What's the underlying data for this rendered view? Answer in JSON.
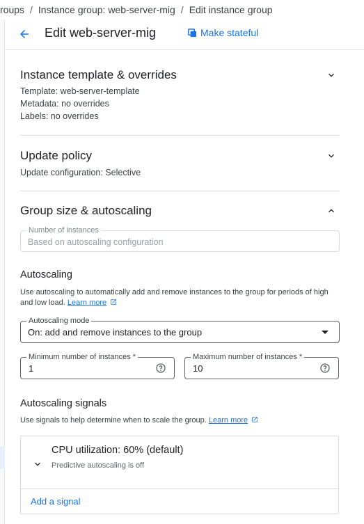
{
  "breadcrumb": {
    "items": [
      "roups",
      "Instance group: web-server-mig",
      "Edit instance group"
    ],
    "separator": "/"
  },
  "header": {
    "title": "Edit web-server-mig",
    "make_stateful_label": "Make stateful",
    "back_icon": "arrow-back-icon"
  },
  "template_section": {
    "title": "Instance template & overrides",
    "lines": [
      "Template: web-server-template",
      "Metadata: no overrides",
      "Labels: no overrides"
    ]
  },
  "update_section": {
    "title": "Update policy",
    "line": "Update configuration: Selective"
  },
  "group_section": {
    "title": "Group size & autoscaling",
    "num_instances_label": "Number of instances",
    "num_instances_placeholder": "Based on autoscaling configuration"
  },
  "autoscaling": {
    "title": "Autoscaling",
    "description": "Use autoscaling to automatically add and remove instances to the group for periods of high and low load.",
    "learn_more": "Learn more",
    "mode_label": "Autoscaling mode",
    "mode_value": "On: add and remove instances to the group",
    "min_label": "Minimum number of instances *",
    "min_value": "1",
    "max_label": "Maximum number of instances *",
    "max_value": "10"
  },
  "signals": {
    "title": "Autoscaling signals",
    "description": "Use signals to help determine when to scale the group.",
    "learn_more": "Learn more",
    "cpu_title": "CPU utilization: 60% (default)",
    "cpu_sub": "Predictive autoscaling is off",
    "add_signal": "Add a signal"
  },
  "colors": {
    "accent": "#1a73e8",
    "divider": "#dadce0",
    "text": "#202124"
  }
}
